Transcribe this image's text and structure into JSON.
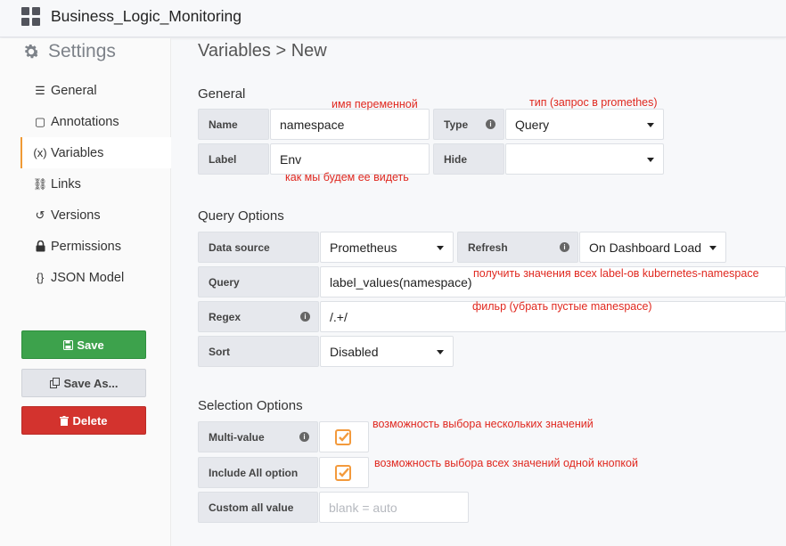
{
  "header": {
    "title": "Business_Logic_Monitoring"
  },
  "sidebar": {
    "title": "Settings",
    "items": [
      {
        "label": "General",
        "icon": "sliders-icon",
        "glyph": "☰"
      },
      {
        "label": "Annotations",
        "icon": "comment-icon",
        "glyph": "▢"
      },
      {
        "label": "Variables",
        "icon": "variable-icon",
        "glyph": "(x)",
        "active": true
      },
      {
        "label": "Links",
        "icon": "link-icon",
        "glyph": "⛓"
      },
      {
        "label": "Versions",
        "icon": "history-icon",
        "glyph": "↺"
      },
      {
        "label": "Permissions",
        "icon": "lock-icon",
        "glyph": "🔒"
      },
      {
        "label": "JSON Model",
        "icon": "json-icon",
        "glyph": "{}"
      }
    ],
    "buttons": {
      "save": "Save",
      "save_as": "Save As...",
      "delete": "Delete"
    }
  },
  "main": {
    "breadcrumb": "Variables > New",
    "general": {
      "title": "General",
      "name_label": "Name",
      "name_value": "namespace",
      "type_label": "Type",
      "type_value": "Query",
      "label_label": "Label",
      "label_value": "Env",
      "hide_label": "Hide",
      "hide_value": ""
    },
    "query_options": {
      "title": "Query Options",
      "datasource_label": "Data source",
      "datasource_value": "Prometheus",
      "refresh_label": "Refresh",
      "refresh_value": "On Dashboard Load",
      "query_label": "Query",
      "query_value": "label_values(namespace)",
      "regex_label": "Regex",
      "regex_value": "/.+/",
      "sort_label": "Sort",
      "sort_value": "Disabled"
    },
    "selection_options": {
      "title": "Selection Options",
      "multi_label": "Multi-value",
      "multi_checked": true,
      "include_all_label": "Include All option",
      "include_all_checked": true,
      "custom_all_label": "Custom all value",
      "custom_all_placeholder": "blank = auto"
    }
  },
  "annotations": {
    "var_name": "имя переменной",
    "type_note": "тип (запрос в promethes)",
    "label_note": "как мы будем ее видеть",
    "query_note": "получить значения всех label-ов kubernetes-namespace",
    "regex_note": "фильр (убрать пустые manespace)",
    "multi_note": "возможность выбора нескольких значений",
    "include_all_note": "возможность выбора всех значений одной кнопкой"
  },
  "colors": {
    "accent": "#f39a3c",
    "save": "#3da24c",
    "delete": "#d3332e",
    "annotation": "#e0281f"
  }
}
